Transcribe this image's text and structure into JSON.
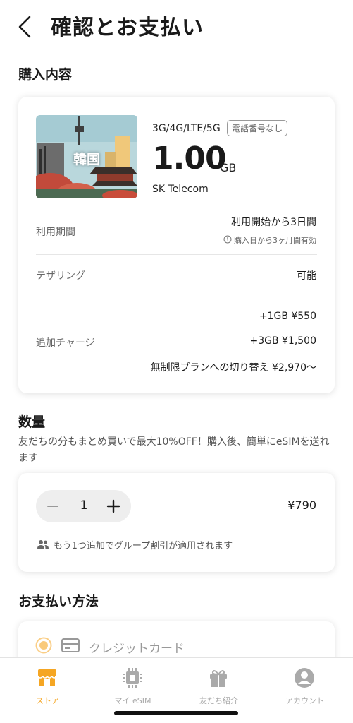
{
  "colors": {
    "accent": "#f5a623",
    "inactive": "#aaaaaa"
  },
  "header": {
    "back_icon": "chevron-left-icon",
    "title": "確認とお支払い"
  },
  "purchase": {
    "section_title": "購入内容",
    "thumbnail_label": "韓国",
    "network": "3G/4G/LTE/5G",
    "badge": "電話番号なし",
    "data_amount": "1.00",
    "data_unit": "GB",
    "carrier": "SK Telecom",
    "period": {
      "label": "利用期間",
      "value": "利用開始から3日間",
      "note": "購入日から3ヶ月間有効",
      "note_icon": "info-icon"
    },
    "tethering": {
      "label": "テザリング",
      "value": "可能"
    },
    "topup": {
      "label": "追加チャージ",
      "options": [
        "+1GB ¥550",
        "+3GB ¥1,500",
        "無制限プランへの切り替え ¥2,970〜"
      ]
    }
  },
  "quantity": {
    "section_title": "数量",
    "promo": "友だちの分もまとめ買いで最大10%OFF！購入後、簡単にeSIMを送れます",
    "value": "1",
    "price": "¥790",
    "group_note": "もう1つ追加でグループ割引が適用されます",
    "group_icon": "people-icon"
  },
  "payment": {
    "section_title": "お支払い方法",
    "option_label": "クレジットカード",
    "option_icon": "credit-card-icon",
    "selected": true
  },
  "tabs": [
    {
      "label": "ストア",
      "icon": "store-icon",
      "active": true
    },
    {
      "label": "マイ eSIM",
      "icon": "sim-chip-icon",
      "active": false
    },
    {
      "label": "友だち紹介",
      "icon": "gift-icon",
      "active": false
    },
    {
      "label": "アカウント",
      "icon": "account-icon",
      "active": false
    }
  ]
}
